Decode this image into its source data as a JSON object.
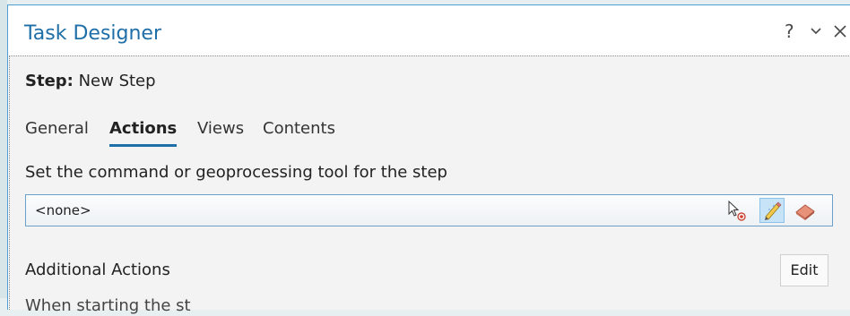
{
  "pane": {
    "title": "Task Designer",
    "controls": {
      "help": "?",
      "dropdown": "⌄",
      "close": "✕"
    }
  },
  "step": {
    "label": "Step:",
    "value": "New Step"
  },
  "tabs": [
    {
      "label": "General",
      "active": false
    },
    {
      "label": "Actions",
      "active": true
    },
    {
      "label": "Views",
      "active": false
    },
    {
      "label": "Contents",
      "active": false
    }
  ],
  "prompt": "Set the command or geoprocessing tool for the step",
  "command_field": {
    "value": "<none>",
    "icons": [
      "pick-command-icon",
      "edit-pencil-icon",
      "eraser-icon"
    ]
  },
  "additional_actions": {
    "heading": "Additional Actions",
    "edit_label": "Edit",
    "next_line": "When starting the st"
  },
  "colors": {
    "accent": "#1e6ea8",
    "border": "#4f9ed6",
    "background": "#f3f3f3"
  }
}
